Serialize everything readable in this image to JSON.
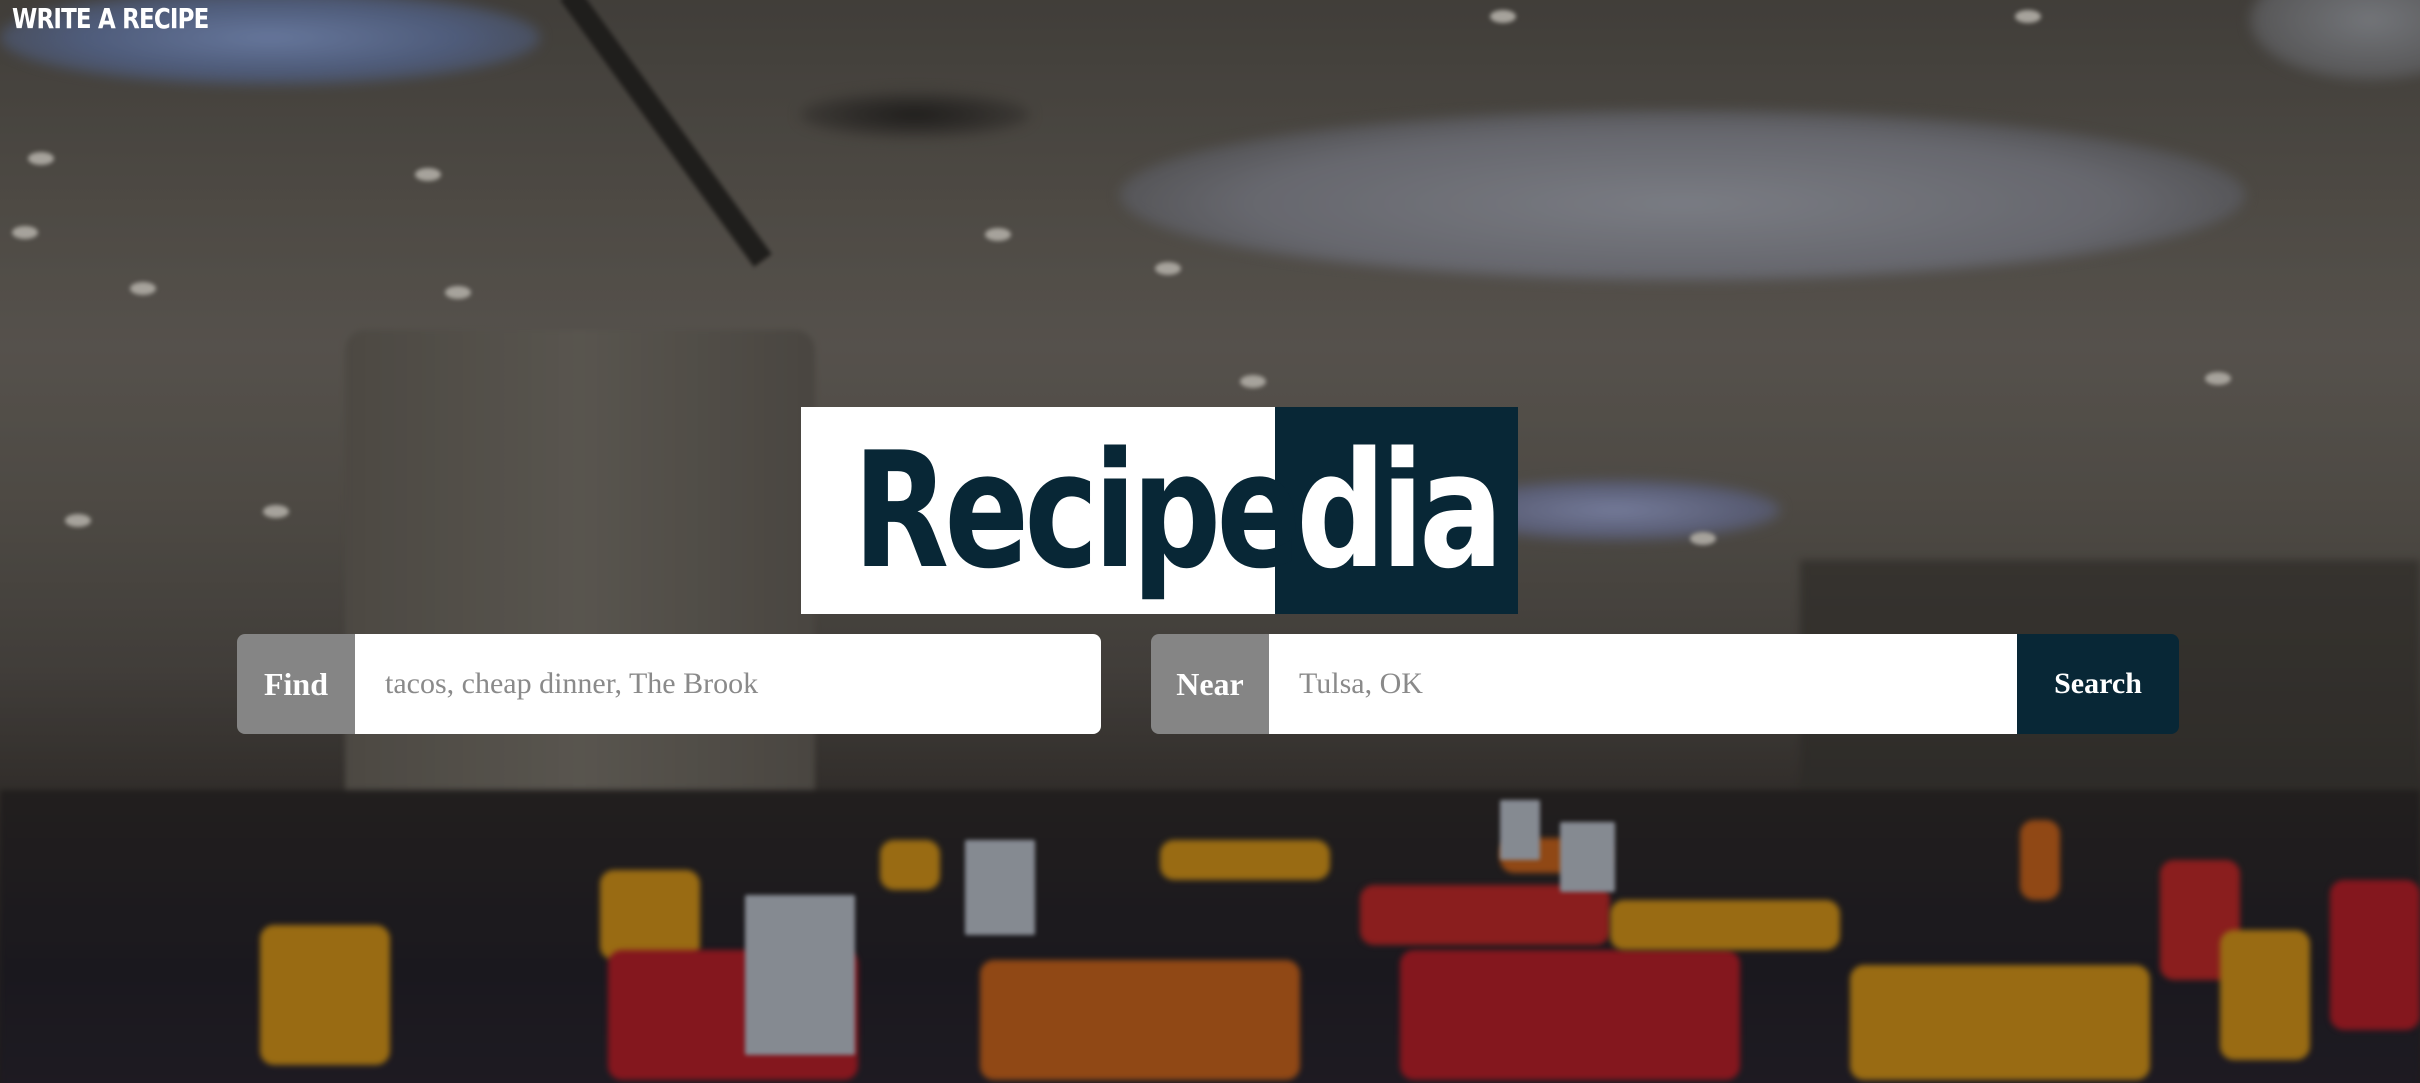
{
  "nav": {
    "write_recipe": "WRITE A RECIPE"
  },
  "logo": {
    "text_dark": "Recipe",
    "text_light": "dia",
    "brand_color": "#082736"
  },
  "search": {
    "find_label": "Find",
    "find_placeholder": "tacos, cheap dinner, The Brook",
    "find_value": "",
    "near_label": "Near",
    "near_placeholder": "Tulsa, OK",
    "near_value": "",
    "submit_label": "Search"
  }
}
